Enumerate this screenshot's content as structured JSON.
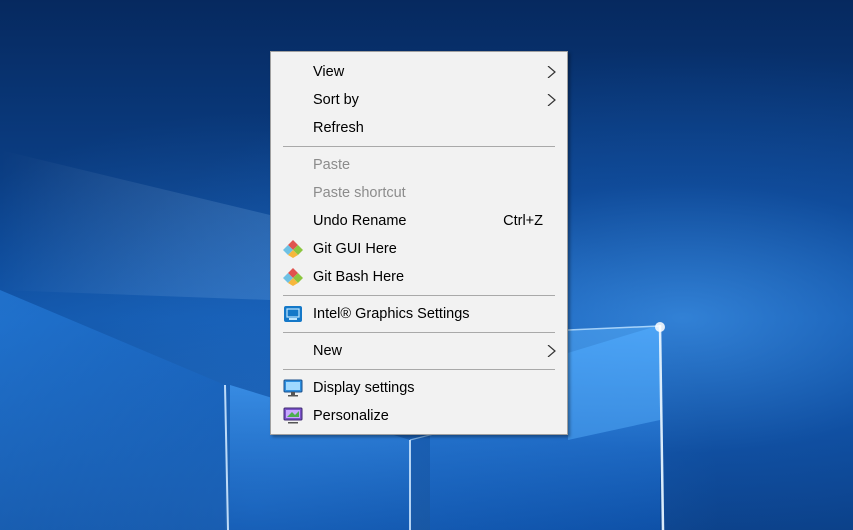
{
  "context_menu": {
    "items": {
      "view": {
        "label": "View",
        "has_submenu": true
      },
      "sort_by": {
        "label": "Sort by",
        "has_submenu": true
      },
      "refresh": {
        "label": "Refresh"
      },
      "paste": {
        "label": "Paste",
        "disabled": true
      },
      "paste_shortcut": {
        "label": "Paste shortcut",
        "disabled": true
      },
      "undo_rename": {
        "label": "Undo Rename",
        "shortcut": "Ctrl+Z"
      },
      "git_gui_here": {
        "label": "Git GUI Here",
        "icon": "git-icon"
      },
      "git_bash_here": {
        "label": "Git Bash Here",
        "icon": "git-icon"
      },
      "intel_graphics": {
        "label": "Intel® Graphics Settings",
        "icon": "intel-graphics-icon"
      },
      "new": {
        "label": "New",
        "has_submenu": true
      },
      "display_settings": {
        "label": "Display settings",
        "icon": "display-icon"
      },
      "personalize": {
        "label": "Personalize",
        "icon": "personalize-icon"
      }
    }
  },
  "colors": {
    "menu_background": "#f2f2f2",
    "menu_border": "#a0a0a0",
    "disabled_text": "#8c8c8c",
    "desktop_blue": "#0d4fa3"
  }
}
